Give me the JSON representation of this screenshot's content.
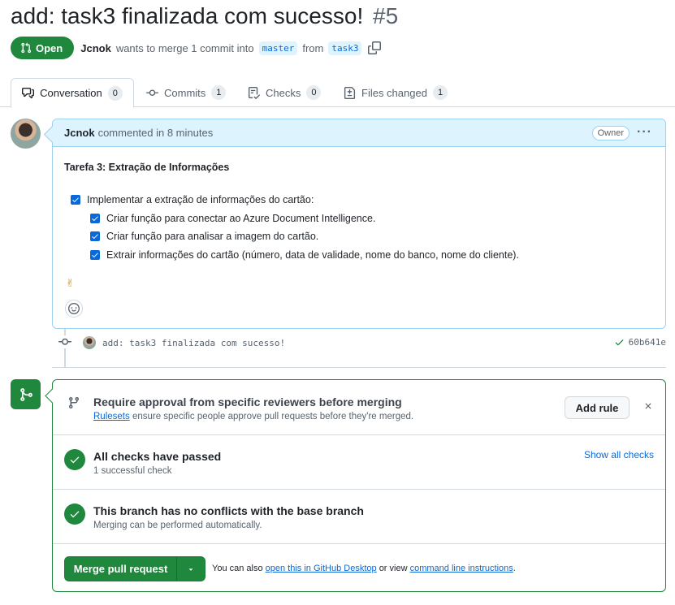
{
  "pr": {
    "title": "add: task3 finalizada com sucesso!",
    "number": "#5",
    "state": "Open",
    "author": "Jcnok",
    "merge_text": "wants to merge 1 commit into",
    "base_branch": "master",
    "from_text": "from",
    "head_branch": "task3"
  },
  "tabs": [
    {
      "label": "Conversation",
      "count": "0",
      "icon": "comment-discussion-icon"
    },
    {
      "label": "Commits",
      "count": "1",
      "icon": "git-commit-icon"
    },
    {
      "label": "Checks",
      "count": "0",
      "icon": "checklist-icon"
    },
    {
      "label": "Files changed",
      "count": "1",
      "icon": "file-diff-icon"
    }
  ],
  "comment": {
    "author": "Jcnok",
    "meta": "commented in 8 minutes",
    "role_badge": "Owner",
    "heading": "Tarefa 3: Extração de Informações",
    "tasks": [
      {
        "text": "Implementar a extração de informações do cartão:",
        "checked": true
      },
      {
        "text": "Criar função para conectar ao Azure Document Intelligence.",
        "checked": true
      },
      {
        "text": "Criar função para analisar a imagem do cartão.",
        "checked": true
      },
      {
        "text": "Extrair informações do cartão (número, data de validade, nome do banco, nome do cliente).",
        "checked": true
      }
    ],
    "emoji": "✌"
  },
  "commit": {
    "message": "add: task3 finalizada com sucesso!",
    "sha": "60b641e"
  },
  "merge": {
    "ruleset_title": "Require approval from specific reviewers before merging",
    "ruleset_link": "Rulesets",
    "ruleset_sub": "ensure specific people approve pull requests before they're merged.",
    "add_rule_label": "Add rule",
    "checks_title": "All checks have passed",
    "checks_sub": "1 successful check",
    "show_all_checks": "Show all checks",
    "conflicts_title": "This branch has no conflicts with the base branch",
    "conflicts_sub": "Merging can be performed automatically.",
    "merge_button": "Merge pull request",
    "note_prefix": "You can also",
    "note_link1": "open this in GitHub Desktop",
    "note_mid": "or view",
    "note_link2": "command line instructions",
    "note_suffix": "."
  },
  "colors": {
    "green": "#1f883d",
    "blue": "#0969da",
    "comment_header_bg": "#ddf4ff"
  }
}
